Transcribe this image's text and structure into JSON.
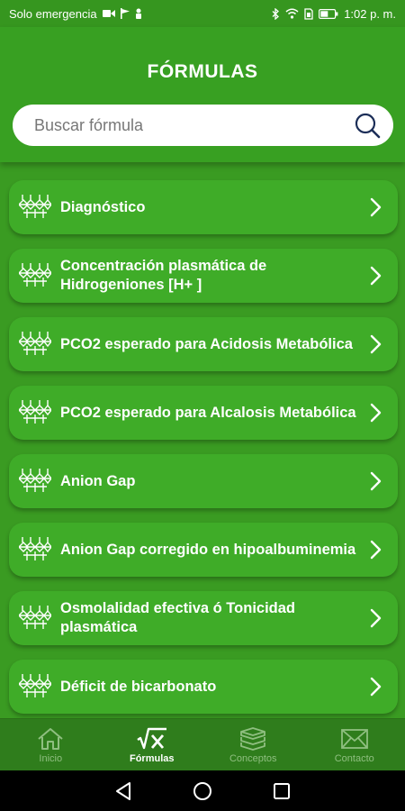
{
  "status_bar": {
    "carrier": "Solo emergencia",
    "time": "1:02 p. m."
  },
  "header": {
    "title": "FÓRMULAS"
  },
  "search": {
    "placeholder": "Buscar fórmula"
  },
  "formulas": [
    {
      "label": "Diagnóstico"
    },
    {
      "label": "Concentración plasmática de Hidrogeniones [H+ ]"
    },
    {
      "label": "PCO2 esperado para Acidosis Metabólica"
    },
    {
      "label": "PCO2 esperado para Alcalosis Metabólica"
    },
    {
      "label": "Anion Gap"
    },
    {
      "label": "Anion Gap corregido en hipoalbuminemia"
    },
    {
      "label": "Osmolalidad efectiva ó Tonicidad plasmática"
    },
    {
      "label": "Déficit de bicarbonato"
    }
  ],
  "item_icon": "molecule-icon",
  "bottom_nav": {
    "active": "formulas",
    "items": [
      {
        "label": "Inicio",
        "icon": "home-icon"
      },
      {
        "label": "Fórmulas",
        "icon": "sqrt-x-icon"
      },
      {
        "label": "Conceptos",
        "icon": "books-icon"
      },
      {
        "label": "Contacto",
        "icon": "envelope-icon"
      }
    ]
  },
  "colors": {
    "background": "#3a9b22",
    "card": "#3fac28",
    "nav_bar": "#2f7d1c",
    "nav_inactive": "#8fbf80"
  }
}
